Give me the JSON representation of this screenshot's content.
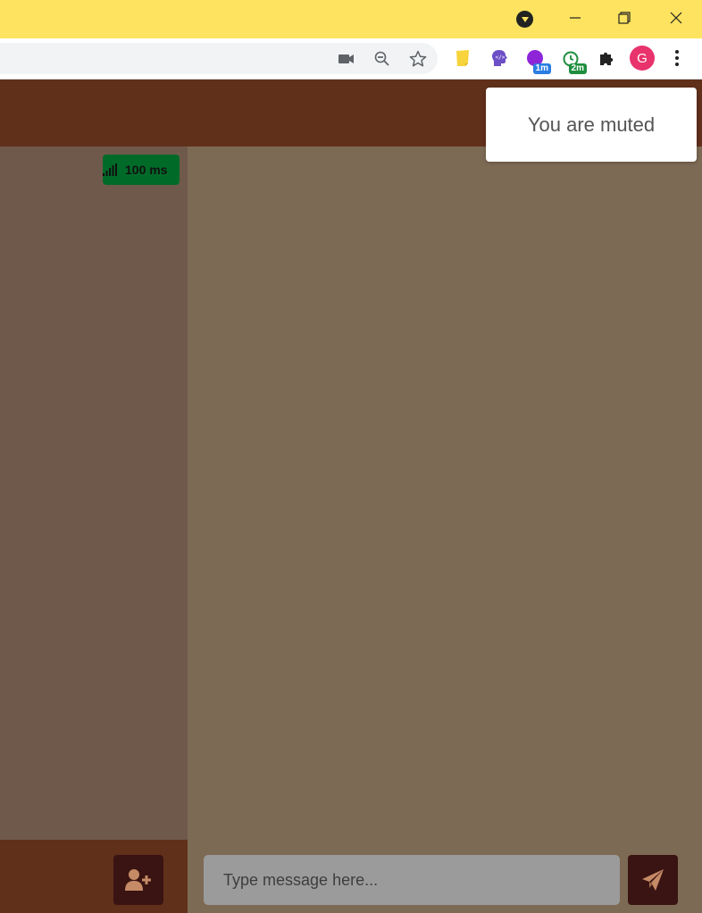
{
  "colors": {
    "titlebar": "#fde35f",
    "app_header": "#61301b",
    "sidebar": "#6f594b",
    "chat_area": "#7d6a54",
    "ping_badge": "#006b29",
    "button_dark": "#3a1412",
    "accent_icon": "#c58a66"
  },
  "browser": {
    "profile_initial": "G",
    "extensions": [
      {
        "name": "sticky-notes-icon"
      },
      {
        "name": "brain-extension-icon"
      },
      {
        "name": "timer-extension-icon",
        "badge": "1m"
      },
      {
        "name": "alarm-extension-icon",
        "badge": "2m"
      },
      {
        "name": "puzzle-icon"
      }
    ],
    "omnibox_icons": [
      "video-camera-icon",
      "zoom-out-icon",
      "star-icon"
    ]
  },
  "app": {
    "ping": "100 ms",
    "toast": "You are muted",
    "message_placeholder": "Type message here..."
  }
}
